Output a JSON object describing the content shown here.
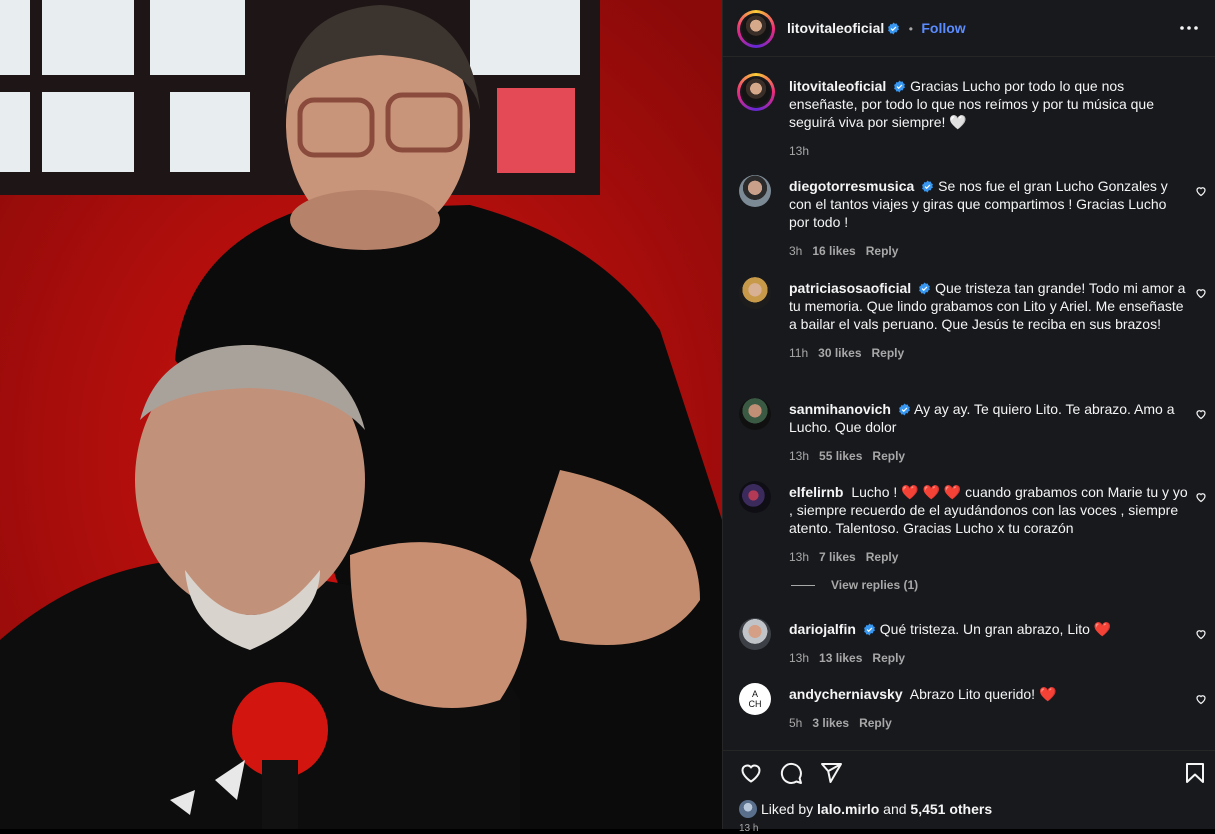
{
  "post": {
    "author": "litovitaleoficial",
    "follow_label": "Follow",
    "separator": "•",
    "caption": {
      "user": "litovitaleoficial",
      "text": "Gracias Lucho por todo lo que nos enseñaste, por todo lo que nos reímos y por tu música que seguirá viva por siempre! 🤍",
      "time": "13h"
    }
  },
  "comments": [
    {
      "user": "diegotorresmusica",
      "verified": true,
      "text": "Se nos fue el gran Lucho Gonzales y con el tantos viajes y giras que compartimos ! Gracias Lucho por todo !",
      "time": "3h",
      "likes": "16 likes",
      "reply": "Reply"
    },
    {
      "user": "patriciasosaoficial",
      "verified": true,
      "text": "Que tristeza tan grande! Todo mi amor a tu memoria. Que lindo grabamos con Lito y Ariel. Me enseñaste a bailar el vals peruano. Que Jesús te reciba en sus brazos!",
      "time": "11h",
      "likes": "30 likes",
      "reply": "Reply"
    },
    {
      "user": "sanmihanovich",
      "verified": true,
      "text": "Ay ay ay. Te quiero Lito. Te abrazo. Amo a Lucho. Que dolor",
      "time": "13h",
      "likes": "55 likes",
      "reply": "Reply"
    },
    {
      "user": "elfelirnb",
      "verified": false,
      "text_before": "Lucho !",
      "hearts": "❤️ ❤️ ❤️",
      "text_after": "cuando grabamos con Marie tu y yo , siempre recuerdo de el ayudándonos con las voces , siempre atento. Talentoso. Gracias Lucho x tu corazón",
      "time": "13h",
      "likes": "7 likes",
      "reply": "Reply"
    },
    {
      "user": "dariojalfin",
      "verified": true,
      "text": "Qué tristeza. Un gran abrazo, Lito",
      "heart": "❤️",
      "time": "13h",
      "likes": "13 likes",
      "reply": "Reply"
    },
    {
      "user": "andycherniavsky",
      "verified": false,
      "avatar_text": "A CH",
      "text": "Abrazo Lito querido!",
      "heart": "❤️",
      "time": "5h",
      "likes": "3 likes",
      "reply": "Reply"
    }
  ],
  "view_replies": "View replies (1)",
  "liked_by": {
    "prefix": "Liked by",
    "user": "lalo.mirlo",
    "and": "and",
    "others": "5,451 others"
  },
  "timestamp_partial": "13 h",
  "icons": [
    "heart-icon",
    "comment-icon",
    "share-icon",
    "bookmark-icon",
    "more-icon",
    "verified-icon"
  ],
  "colors": {
    "accent": "#5b8cff",
    "verified": "#3897f0",
    "heart": "#ff3040",
    "panel": "#18191d"
  }
}
